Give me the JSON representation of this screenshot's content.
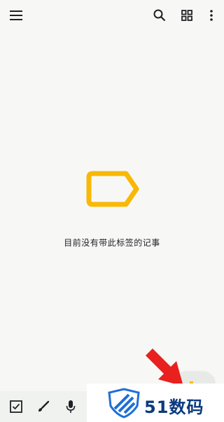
{
  "toolbar": {
    "menu_icon": "menu-icon",
    "search_icon": "search-icon",
    "grid_view_icon": "grid-view-icon",
    "more_icon": "more-vert-icon"
  },
  "empty_state": {
    "message": "目前没有带此标签的记事",
    "glyph": "label-outline-icon",
    "glyph_color": "#f9b806"
  },
  "bottom_bar": {
    "items": [
      {
        "icon": "checkbox-icon"
      },
      {
        "icon": "brush-icon"
      },
      {
        "icon": "mic-icon"
      }
    ]
  },
  "fab": {
    "icon": "plus-icon"
  },
  "watermark": {
    "text": "51数码",
    "color": "#0b3a7e"
  },
  "colors": {
    "background": "#f7f8f6",
    "accent_yellow": "#f9b806",
    "arrow_red": "#e8201e"
  }
}
